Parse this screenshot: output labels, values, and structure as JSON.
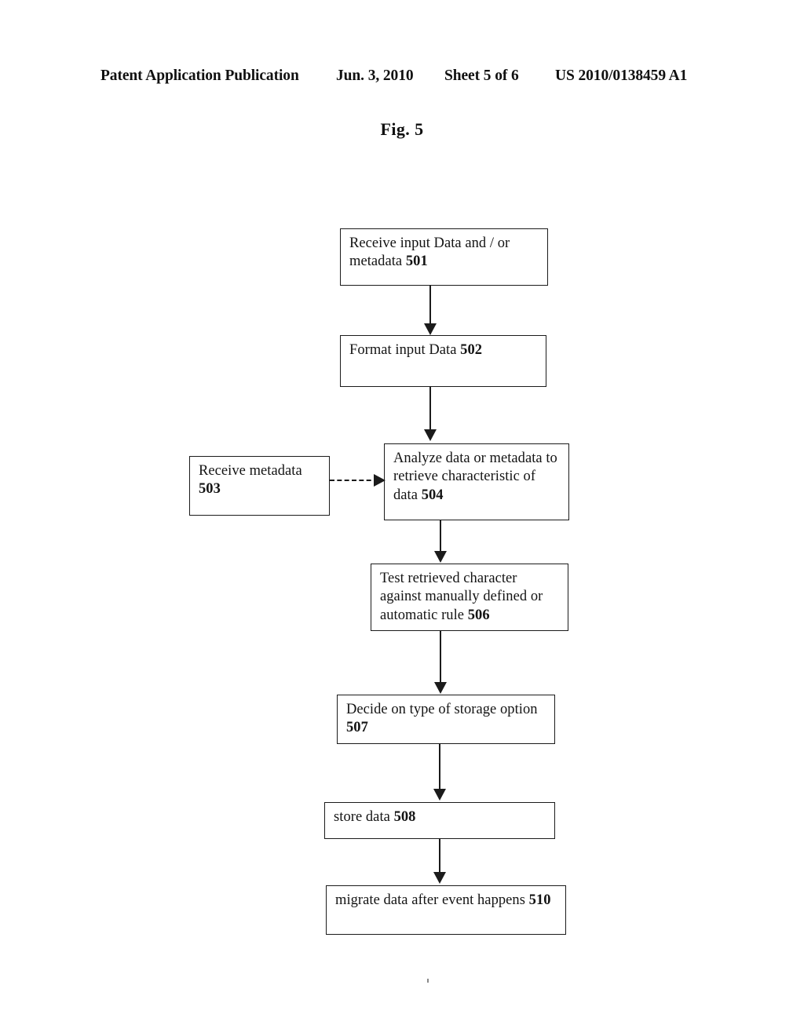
{
  "header": {
    "publication": "Patent Application Publication",
    "date": "Jun. 3, 2010",
    "sheet": "Sheet 5 of 6",
    "document_number": "US 2010/0138459 A1"
  },
  "figure": {
    "title": "Fig. 5",
    "type": "flowchart"
  },
  "nodes": [
    {
      "id": "501",
      "text": "Receive input Data and / or metadata ",
      "ref": "501",
      "label": "Receive input Data and / or metadata 501"
    },
    {
      "id": "502",
      "text": "Format input Data ",
      "ref": "502",
      "label": "Format input Data 502"
    },
    {
      "id": "503",
      "text": "Receive metadata ",
      "ref": "503",
      "label": "Receive metadata 503"
    },
    {
      "id": "504",
      "text": "Analyze data or metadata to retrieve characteristic of data ",
      "ref": "504",
      "label": "Analyze data or metadata to retrieve characteristic of data 504"
    },
    {
      "id": "506",
      "text": "Test retrieved character against manually defined or automatic rule ",
      "ref": "506",
      "label": "Test retrieved character against manually defined or automatic rule 506"
    },
    {
      "id": "507",
      "text": "Decide on type of storage option ",
      "ref": "507",
      "label": "Decide on type of storage option 507"
    },
    {
      "id": "508",
      "text": "store data ",
      "ref": "508",
      "label": "store data 508"
    },
    {
      "id": "510",
      "text": "migrate data after event happens ",
      "ref": "510",
      "label": "migrate data after event happens 510"
    }
  ],
  "connectors": [
    {
      "id": "c-501-502",
      "from": "501",
      "to": "502",
      "style": "solid",
      "direction": "down"
    },
    {
      "id": "c-502-504",
      "from": "502",
      "to": "504",
      "style": "solid",
      "direction": "down"
    },
    {
      "id": "c-503-504",
      "from": "503",
      "to": "504",
      "style": "dashed",
      "direction": "right"
    },
    {
      "id": "c-504-506",
      "from": "504",
      "to": "506",
      "style": "solid",
      "direction": "down"
    },
    {
      "id": "c-506-507",
      "from": "506",
      "to": "507",
      "style": "solid",
      "direction": "down"
    },
    {
      "id": "c-507-508",
      "from": "507",
      "to": "508",
      "style": "solid",
      "direction": "down"
    },
    {
      "id": "c-508-510",
      "from": "508",
      "to": "510",
      "style": "solid",
      "direction": "down"
    }
  ],
  "colors": {
    "ink": "#1b1b1b",
    "paper": "#ffffff"
  }
}
